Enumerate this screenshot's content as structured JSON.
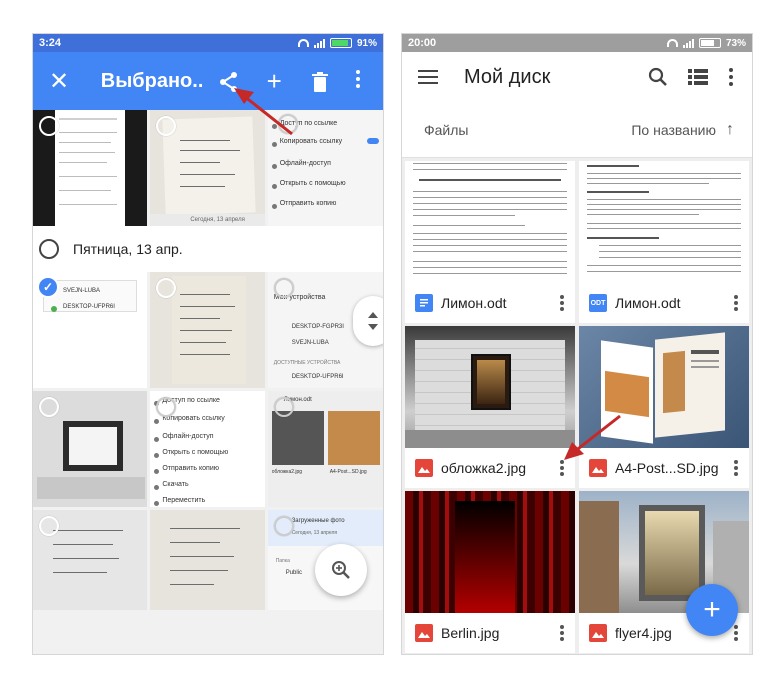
{
  "left_phone": {
    "status_bar": {
      "time": "3:24",
      "battery": "91%",
      "battery_level": 0.91
    },
    "app_bar": {
      "title": "Выбрано...",
      "close_icon": "close-icon",
      "share_icon": "share-icon",
      "add_icon": "plus-icon",
      "delete_icon": "trash-icon",
      "more_icon": "more-vert-icon"
    },
    "date_header": "Пятница, 13 апр.",
    "tile_texts": {
      "menu_a": [
        "Доступ по ссылке",
        "Копировать ссылку",
        "Офлайн-доступ",
        "Открыть с помощью",
        "Отправить копию"
      ],
      "devices_header": "Мои устройства",
      "devices": [
        "DESKTOP-FGPR3I",
        "SVEJN-LUBA",
        "DESKTOP-UFPR6I"
      ],
      "available": "ДОСТУПНЫЕ УСТРОЙСТВА",
      "luba": "SVEJN-LUBA",
      "desk": "DESKTOP-UFPR6I",
      "menu_b": [
        "Доступ по ссылке",
        "Копировать ссылку",
        "Офлайн-доступ",
        "Открыть с помощью",
        "Отправить копию",
        "Скачать",
        "Переместить"
      ],
      "lemon_small": "Лимон.odt",
      "files_small": [
        "обложка2.jpg",
        "A4-Post...SD.jpg"
      ],
      "saved_msg": "Загруженные фото",
      "saved_sub": "Сегодня, 13 апреля",
      "folder_label": "Папка",
      "folder_name": "Public",
      "img_caption": "Сегодня, 13 апреля"
    }
  },
  "right_phone": {
    "status_bar": {
      "time": "20:00",
      "battery": "73%",
      "battery_level": 0.73
    },
    "app_bar": {
      "title": "Мой диск",
      "search_icon": "search-icon",
      "view_icon": "list-view-icon",
      "more_icon": "more-vert-icon"
    },
    "sort_row": {
      "label": "Файлы",
      "sort_by": "По названию"
    },
    "files": [
      {
        "name": "Лимон.odt",
        "type": "doc"
      },
      {
        "name": "Лимон.odt",
        "type": "odt"
      },
      {
        "name": "обложка2.jpg",
        "type": "img"
      },
      {
        "name": "A4-Post...SD.jpg",
        "type": "img"
      },
      {
        "name": "Berlin.jpg",
        "type": "img"
      },
      {
        "name": "flyer4.jpg",
        "type": "img"
      }
    ],
    "file_type_badges": {
      "odt": "ODT"
    },
    "fab": "+"
  },
  "colors": {
    "blue_accent": "#4285f4",
    "status_blue": "#3f6fd8",
    "status_grey": "#9e9e9e",
    "arrow_red": "#c62828",
    "img_red": "#e5463a"
  }
}
